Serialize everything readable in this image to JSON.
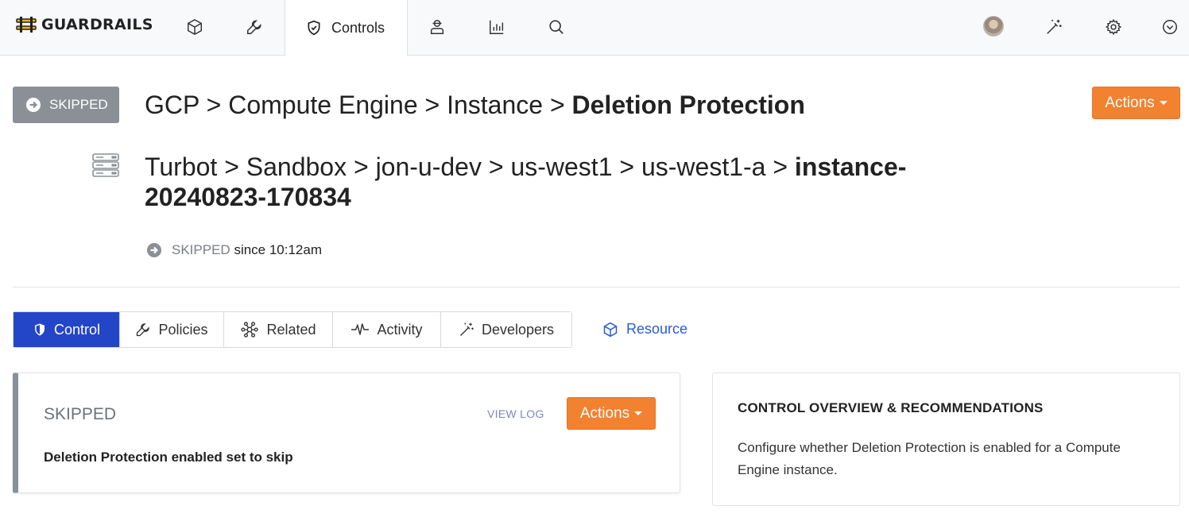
{
  "nav": {
    "brand": "GUARDRAILS",
    "active_tab_label": "Controls",
    "icons": [
      "resources-cube-icon",
      "policies-wrench-icon",
      "controls-shield-icon",
      "actors-user-icon",
      "reports-chart-icon",
      "search-icon",
      "avatar",
      "magic-wand-icon",
      "gear-icon",
      "chevron-down-icon"
    ]
  },
  "header": {
    "status_badge": "SKIPPED",
    "title_path": "GCP > Compute Engine > Instance > ",
    "title_last": "Deletion Protection",
    "actions_label": "Actions",
    "resource_path": "Turbot > Sandbox > jon-u-dev > us-west1 > us-west1-a > ",
    "resource_last": "instance-20240823-170834",
    "since_state": "SKIPPED",
    "since_text": "since 10:12am"
  },
  "tabs": {
    "items": [
      {
        "label": "Control",
        "icon": "shield-icon"
      },
      {
        "label": "Policies",
        "icon": "wrench-icon"
      },
      {
        "label": "Related",
        "icon": "network-icon"
      },
      {
        "label": "Activity",
        "icon": "pulse-icon"
      },
      {
        "label": "Developers",
        "icon": "magic-wand-icon"
      }
    ],
    "resource_link": "Resource"
  },
  "control_card": {
    "state": "SKIPPED",
    "view_log": "VIEW LOG",
    "actions_label": "Actions",
    "reason": "Deletion Protection enabled set to skip"
  },
  "overview": {
    "title": "CONTROL OVERVIEW & RECOMMENDATIONS",
    "text": "Configure whether Deletion Protection is enabled for a Compute Engine instance."
  },
  "colors": {
    "accent_blue": "#2346c8",
    "action_orange": "#f28130",
    "skipped_gray": "#8a9096",
    "link_blue": "#2a5bd7"
  }
}
